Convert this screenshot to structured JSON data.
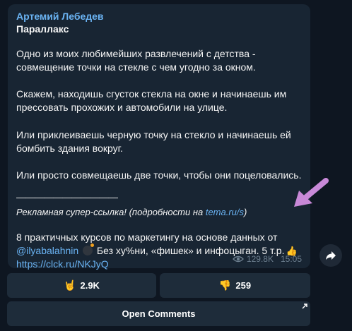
{
  "message": {
    "author": "Артемий Лебедев",
    "title": "Параллакс",
    "paragraphs": [
      "Одно из моих любимейших развлечений с детства - совмещение точки на стекле с чем угодно за окном.",
      "Скажем, находишь сгусток стекла на окне и начинаешь им прессовать прохожих и автомобили на улице.",
      "Или приклеиваешь черную точку на стекло и начинаешь ей бомбить здания вокруг.",
      "Или просто совмещаешь две точки, чтобы они поцеловались."
    ],
    "divider": "———————————",
    "promo_prefix": "Рекламная супер-ссылка! (подробности на ",
    "promo_link": "tema.ru/s",
    "promo_suffix": ")",
    "courses_text": "8 практичных курсов по маркетингу на основе данных от",
    "courses_mention": "@ilyabalahnin",
    "courses_tail": " Без ху%ни, «фишек» и инфоцыган. 5 т.р.",
    "courses_url": "https://clck.ru/NKJyQ",
    "views": "129.8K",
    "time": "15:05"
  },
  "reactions": [
    {
      "emoji": "🤘",
      "count": "2.9K"
    },
    {
      "emoji": "👎",
      "count": "259"
    }
  ],
  "open_comments_label": "Open Comments",
  "icons": {
    "views": "eye-icon",
    "share": "share-icon",
    "annotation": "pink-arrow-icon",
    "open": "external-open-icon"
  },
  "colors": {
    "background": "#0e1621",
    "bubble": "#182533",
    "accent": "#6ab3f3",
    "button": "#1e2c3a",
    "annotation_arrow": "#c889d8"
  }
}
